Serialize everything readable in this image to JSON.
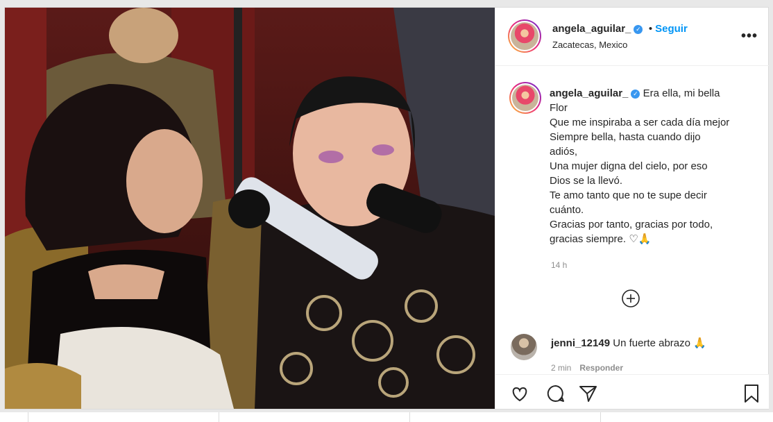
{
  "post": {
    "username": "angela_aguilar_",
    "verified_mark": "✓",
    "follow_label": "Seguir",
    "separator": "•",
    "location": "Zacatecas, Mexico",
    "more_label": "•••"
  },
  "caption": {
    "username": "angela_aguilar_",
    "lines": [
      "Era ella, mi bella",
      "Flor",
      "Que me inspiraba a ser cada día mejor",
      "Siempre bella, hasta cuando dijo",
      "adiós,",
      "Una mujer digna del cielo, por eso",
      "Dios se la llevó.",
      "Te amo tanto que no te supe decir",
      "cuánto.",
      "Gracias por tanto, gracias por todo,",
      "gracias siempre. ♡🙏"
    ],
    "time": "14 h"
  },
  "load_more_icon": "plus-circle-icon",
  "comment": {
    "username": "jenni_12149",
    "text": "Un fuerte abrazo 🙏",
    "time": "2 min",
    "reply_label": "Responder"
  },
  "icons": [
    "heart-icon",
    "comment-icon",
    "share-icon",
    "bookmark-icon"
  ],
  "colors": {
    "accent": "#0095f6",
    "verified": "#3897f0",
    "muted": "#8e8e8e"
  }
}
